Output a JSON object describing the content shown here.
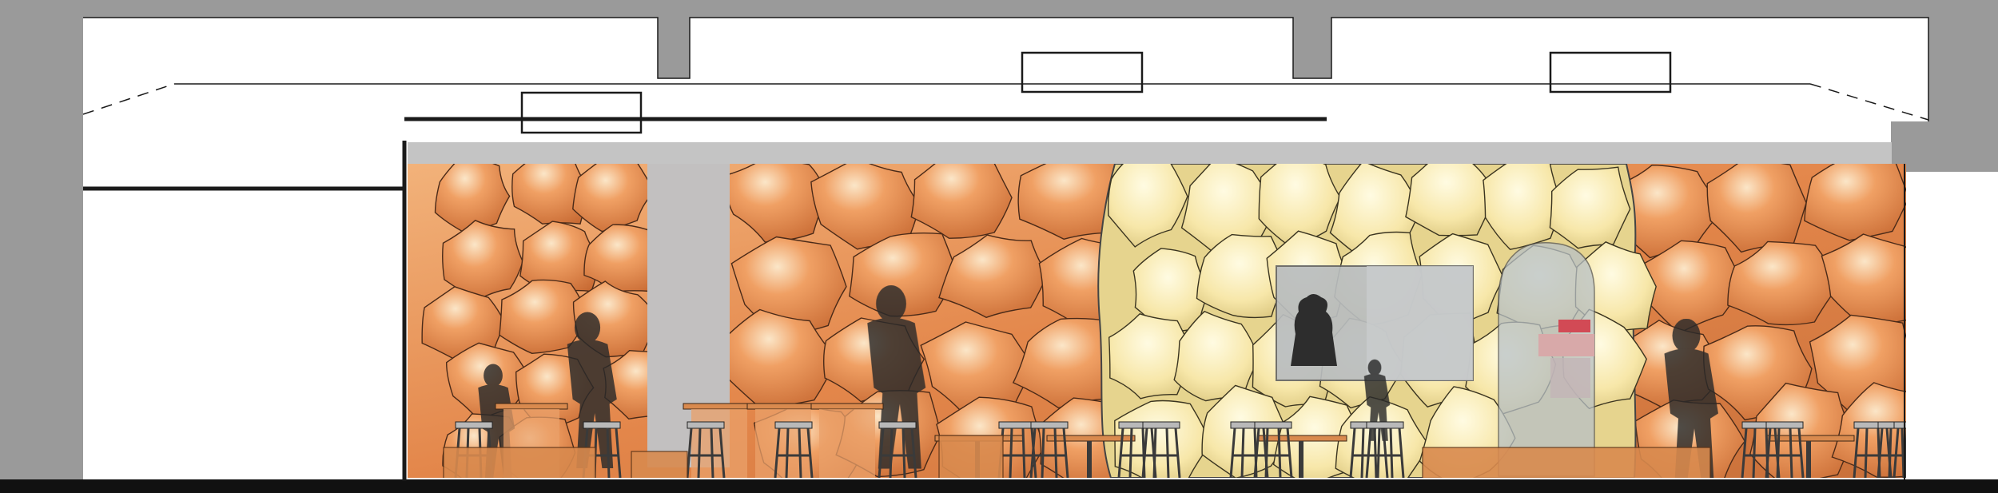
{
  "drawing": {
    "type": "architectural-section",
    "description_text": "",
    "colors": {
      "structure": "#9a9a9a",
      "outline": "#1a1a1a",
      "ceiling_band": "#c4c4c4",
      "wall_base": "#e8955a",
      "wall_shadow": "#c9703a",
      "wall_highlight": "#fbe6c8",
      "bubble_fill": "#f6e6a6",
      "bubble_light": "#fff8d6",
      "column": "#c2c0c0",
      "silhouette": "#2a2a2a",
      "window_glass": "#b8c1c6",
      "furniture_wood": "#d98a4e",
      "stool_metal": "#3a3a3a"
    },
    "cells_per_region": {
      "left_wall": 14,
      "mid_wall": 16,
      "bubble_room": 26,
      "right_wall": 12
    },
    "people_silhouettes": 5,
    "tables": 8,
    "stools": 18
  }
}
